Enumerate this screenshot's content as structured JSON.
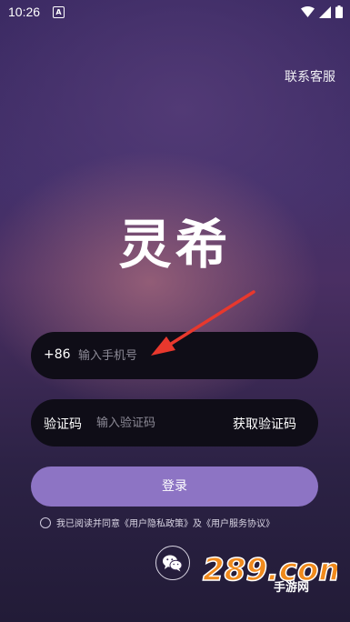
{
  "status_bar": {
    "time": "10:26",
    "notif_icon": "A"
  },
  "header": {
    "service_link": "联系客服"
  },
  "app": {
    "logo_text": "灵希"
  },
  "phone_field": {
    "prefix": "+86",
    "placeholder": "输入手机号"
  },
  "code_field": {
    "label": "验证码",
    "placeholder": "输入验证码",
    "get_code": "获取验证码"
  },
  "login": {
    "label": "登录"
  },
  "agreement": {
    "text_before": "我已阅读并同意",
    "privacy": "《用户隐私政策》",
    "and": "及",
    "terms": "《用户服务协议》"
  },
  "social": {
    "wechat_icon": "wechat-icon"
  },
  "watermark": {
    "brand": "289.com",
    "sub": "手游网"
  },
  "colors": {
    "accent": "#8d74c4",
    "field_bg": "#0f0d17",
    "arrow": "#e8382d"
  }
}
